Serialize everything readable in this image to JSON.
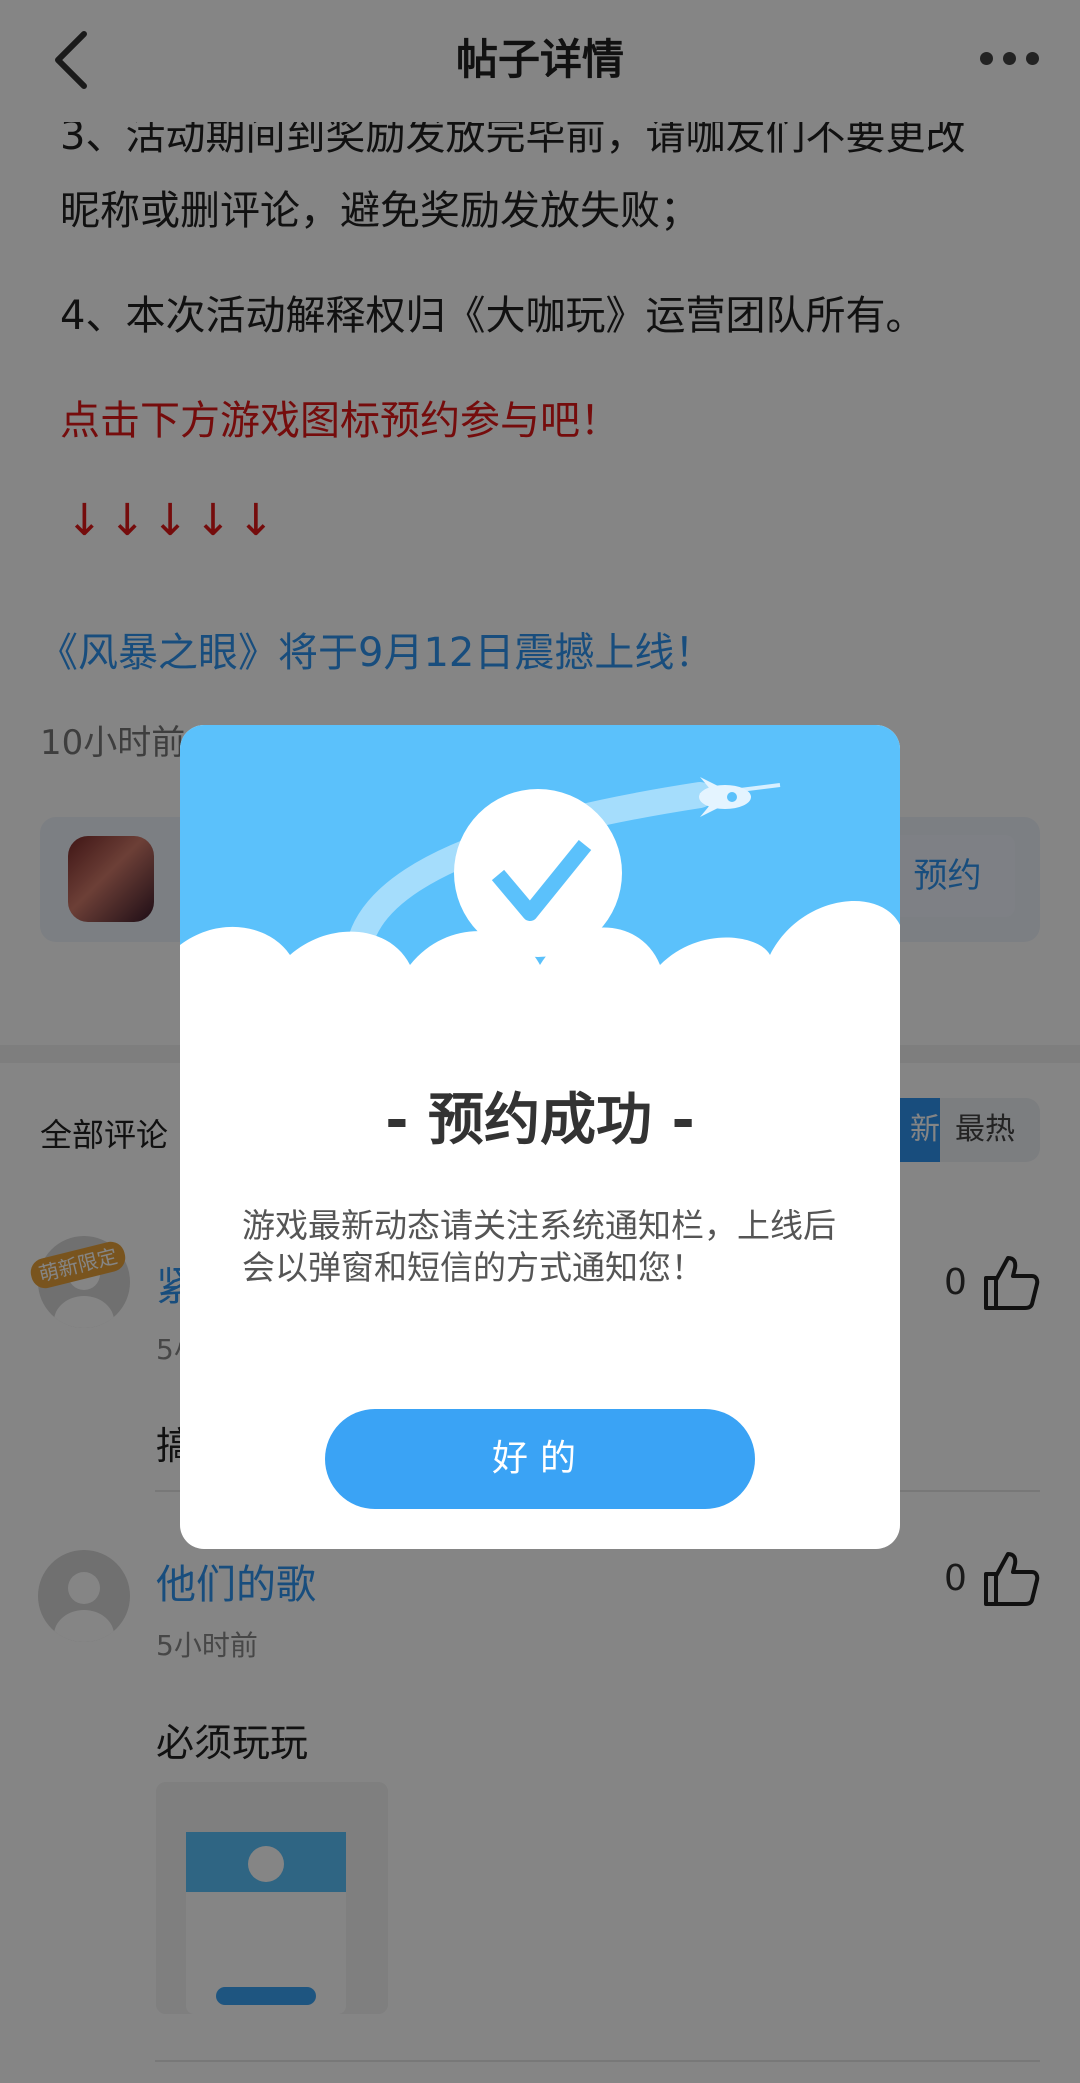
{
  "header": {
    "title": "帖子详情"
  },
  "article": {
    "line1": "3、活动期间到奖励发放完毕前，请咖友们不要更改",
    "line2": "昵称或删评论，避免奖励发放失败；",
    "line3": "4、本次活动解释权归《大咖玩》运营团队所有。",
    "cta": "点击下方游戏图标预约参与吧！",
    "arrows": "↓↓↓↓↓",
    "game_link": "《风暴之眼》将于9月12日震撼上线！",
    "post_time": "10小时前"
  },
  "game_card": {
    "reserve_label": "预约"
  },
  "comments": {
    "title": "全部评论",
    "sort_new": "新",
    "sort_hot": "最热",
    "items": [
      {
        "badge": "萌新限定",
        "name": "紧",
        "time": "5小",
        "text": "搞",
        "likes": "0"
      },
      {
        "name": "他们的歌",
        "time": "5小时前",
        "text": "必须玩玩",
        "likes": "0"
      }
    ]
  },
  "modal": {
    "title": "- 预约成功 -",
    "message": "游戏最新动态请关注系统通知栏，上线后会以弹窗和短信的方式通知您！",
    "ok_label": "好的"
  },
  "colors": {
    "accent": "#3aa3f5",
    "link": "#2f95f0",
    "red": "#e01818",
    "sky": "#5bc1fb"
  }
}
